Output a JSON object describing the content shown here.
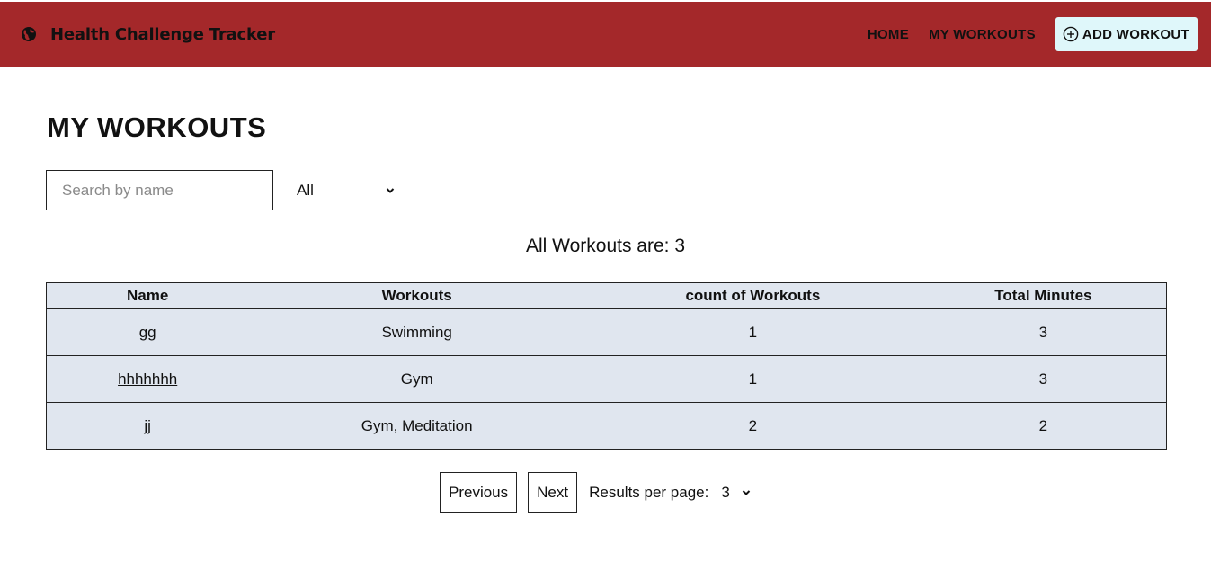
{
  "header": {
    "brand_icon": "globe-icon",
    "title": "Health Challenge Tracker",
    "nav": {
      "home": "HOME",
      "my_workouts": "MY WORKOUTS",
      "add_workout": "ADD WORKOUT",
      "add_icon": "plus-circle-icon"
    },
    "bg_color": "#a4282a",
    "add_button_color": "#dff7fa"
  },
  "main": {
    "page_title": "MY WORKOUTS",
    "search": {
      "placeholder": "Search by name",
      "value": ""
    },
    "filter": {
      "selected": "All"
    },
    "summary": {
      "label": "All Workouts are:",
      "count": "3"
    },
    "table": {
      "headers": [
        "Name",
        "Workouts",
        "count of Workouts",
        "Total Minutes"
      ],
      "rows": [
        {
          "name": "gg",
          "workouts": "Swimming",
          "count": "1",
          "minutes": "3"
        },
        {
          "name": "hhhhhhh",
          "workouts": "Gym",
          "count": "1",
          "minutes": "3"
        },
        {
          "name": "jj",
          "workouts": "Gym, Meditation",
          "count": "2",
          "minutes": "2"
        }
      ],
      "row_bg_color": "#e0e6ef"
    },
    "pagination": {
      "previous": "Previous",
      "next": "Next",
      "results_per_page_label": "Results per page:",
      "results_per_page_value": "3"
    }
  }
}
